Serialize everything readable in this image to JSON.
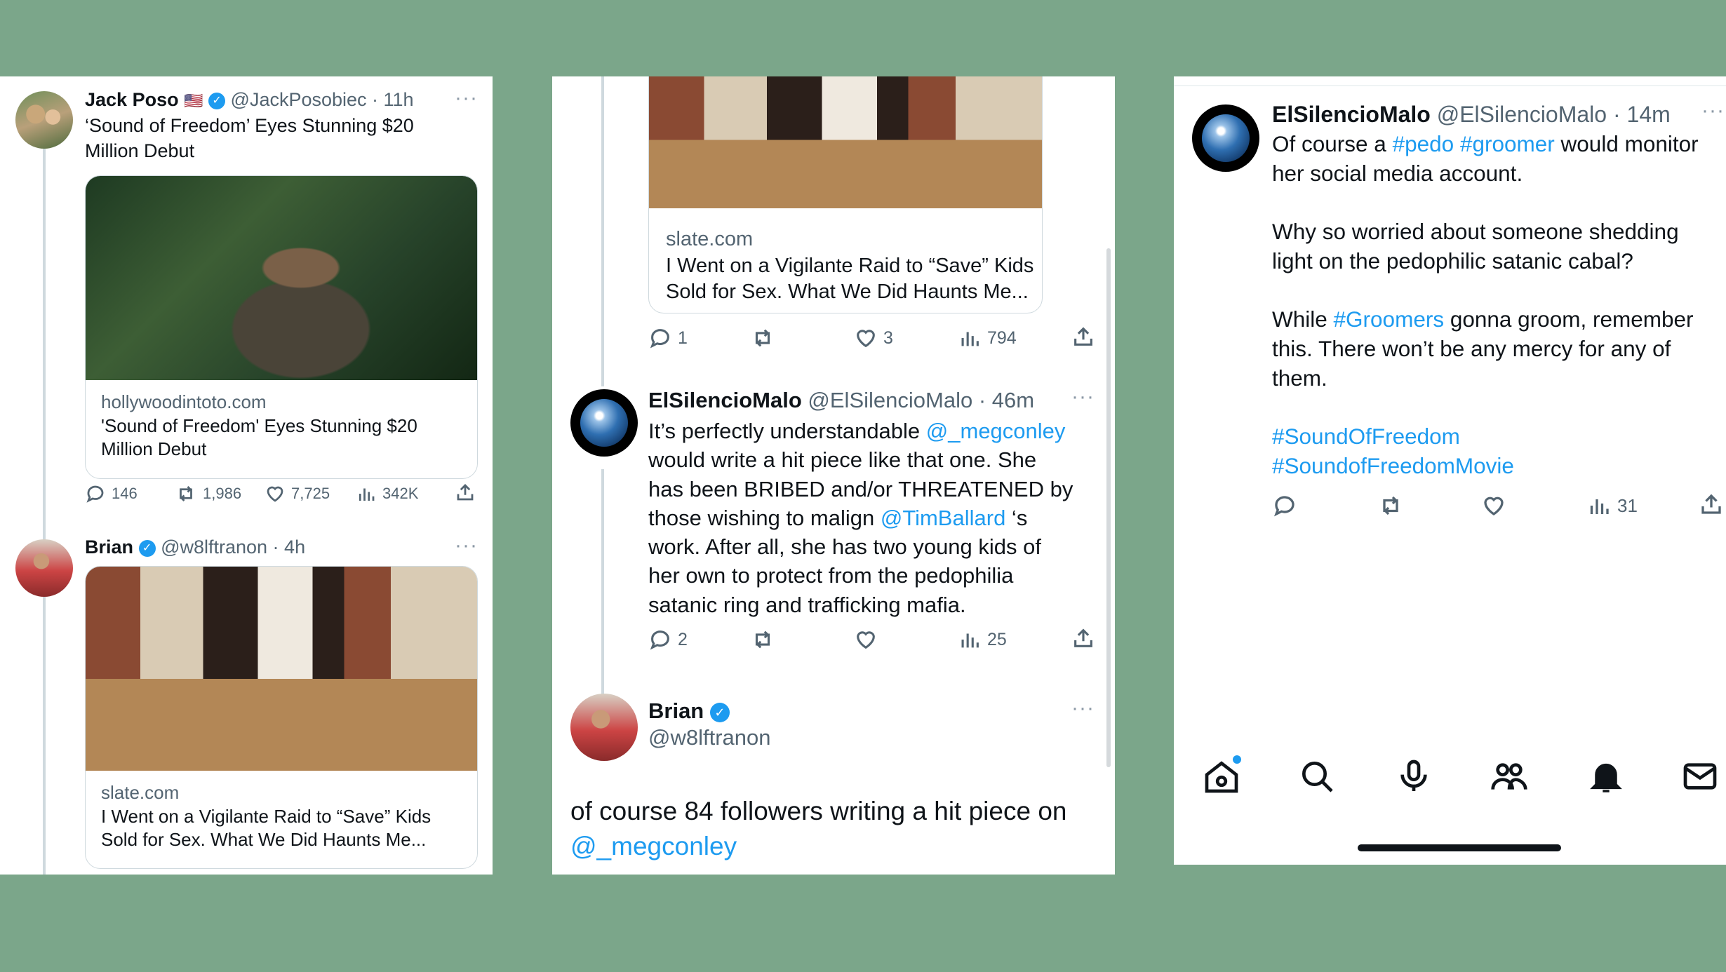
{
  "panel1": {
    "tweet1": {
      "name": "Jack Poso",
      "flag": "🇺🇸",
      "handle": "@JackPosobiec",
      "time": "11h",
      "text_line1": "‘Sound of Freedom’ Eyes Stunning $20",
      "text_line2": "Million Debut",
      "card_domain": "hollywoodintoto.com",
      "card_title_line1": "'Sound of Freedom' Eyes Stunning $20",
      "card_title_line2": "Million Debut",
      "replies": "146",
      "retweets": "1,986",
      "likes": "7,725",
      "views": "342K"
    },
    "tweet2": {
      "name": "Brian",
      "handle": "@w8lftranon",
      "time": "4h",
      "card_domain": "slate.com",
      "card_title_line1": "I Went on a Vigilante Raid to “Save” Kids",
      "card_title_line2": "Sold for Sex. What We Did Haunts Me..."
    }
  },
  "panel2": {
    "card_domain": "slate.com",
    "card_title_line1": "I Went on a Vigilante Raid to “Save” Kids",
    "card_title_line2": "Sold for Sex. What We Did Haunts Me...",
    "card_replies": "1",
    "card_likes": "3",
    "card_views": "794",
    "tweet": {
      "name": "ElSilencioMalo",
      "handle": "@ElSilencioMalo",
      "time": "46m",
      "l1a": "It’s perfectly understandable ",
      "l1b": "@_megconley",
      "l2": "would write a hit piece like that one. She",
      "l3": "has been BRIBED and/or THREATENED by",
      "l4a": "those wishing to malign ",
      "l4b": "@TimBallard",
      "l4c": " ‘s",
      "l5": "work. After all, she has two young kids of",
      "l6": "her own to protect from the pedophilia",
      "l7": "satanic ring and trafficking mafia.",
      "replies": "2",
      "views": "25"
    },
    "brian": {
      "name": "Brian",
      "handle": "@w8lftranon",
      "text_line1": "of course 84 followers writing a hit piece on",
      "text_link": "@_megconley"
    }
  },
  "panel3": {
    "tweet": {
      "name": "ElSilencioMalo",
      "handle": "@ElSilencioMalo",
      "time": "14m",
      "l1a": "Of course a ",
      "l1b": "#pedo",
      "l1c": " ",
      "l1d": "#groomer",
      "l1e": " would monitor",
      "l2": "her social media account.",
      "l3": "Why so worried about someone shedding",
      "l4": "light on the pedophilic satanic cabal?",
      "l5a": "While ",
      "l5b": "#Groomers",
      "l5c": " gonna groom, remember",
      "l6": "this. There won’t be any mercy for any of",
      "l7": "them.",
      "tag1": "#SoundOfFreedom",
      "tag2": "#SoundofFreedomMovie",
      "views": "31"
    }
  },
  "colors": {
    "background": "#7ba68a",
    "link": "#1d9bf0",
    "muted": "#536471"
  }
}
